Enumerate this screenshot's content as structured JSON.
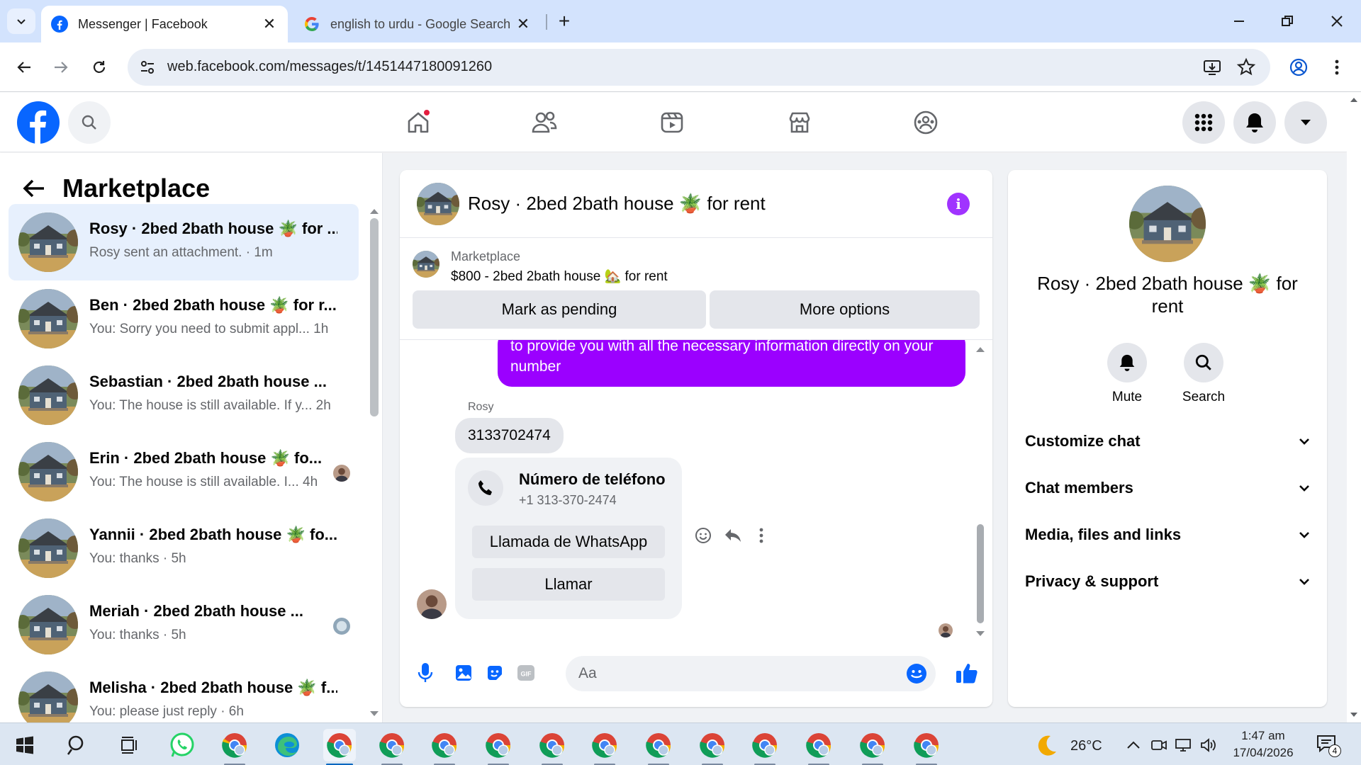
{
  "browser": {
    "tabs": [
      {
        "title": "Messenger | Facebook",
        "active": true
      },
      {
        "title": "english to urdu - Google Search",
        "active": false
      }
    ],
    "url": "web.facebook.com/messages/t/1451447180091260"
  },
  "left_panel": {
    "title": "Marketplace",
    "conversations": [
      {
        "name": "Rosy · 2bed 2bath house 🪴 for ...",
        "preview": "Rosy sent an attachment. · 1m",
        "active": true
      },
      {
        "name": "Ben · 2bed 2bath house 🪴 for r...",
        "preview": "You: Sorry you need to submit appl...  1h"
      },
      {
        "name": "Sebastian · 2bed 2bath house ...",
        "preview": "You: The house is still available. If y...  2h"
      },
      {
        "name": "Erin · 2bed 2bath house 🪴 fo...",
        "preview": "You: The house is still available. I...  4h"
      },
      {
        "name": "Yannii · 2bed 2bath house 🪴 fo...",
        "preview": "You: thanks · 5h"
      },
      {
        "name": "Meriah · 2bed 2bath house ...",
        "preview": "You: thanks · 5h"
      },
      {
        "name": "Melisha · 2bed 2bath house 🪴 f...",
        "preview": "You: please just reply · 6h"
      }
    ]
  },
  "chat": {
    "title": "Rosy · 2bed 2bath house 🪴 for rent",
    "marketplace_label": "Marketplace",
    "listing": "$800 - 2bed 2bath house 🏡 for rent",
    "mark_pending": "Mark as pending",
    "more_options": "More options",
    "outgoing_text": "to provide you with all the necessary information directly on your number",
    "sender": "Rosy",
    "incoming_text": "3133702474",
    "card": {
      "title": "Número de teléfono",
      "number": "+1 313-370-2474",
      "whatsapp_btn": "Llamada de WhatsApp",
      "call_btn": "Llamar"
    },
    "composer_placeholder": "Aa",
    "colors": {
      "outgoing_bubble": "#9b00ff",
      "accent": "#a033ff",
      "fb_blue": "#0866ff"
    }
  },
  "info_panel": {
    "name": "Rosy · 2bed 2bath house 🪴 for rent",
    "actions": [
      {
        "label": "Mute",
        "icon": "bell-icon"
      },
      {
        "label": "Search",
        "icon": "search-icon"
      }
    ],
    "sections": [
      "Customize chat",
      "Chat members",
      "Media, files and links",
      "Privacy & support"
    ]
  },
  "taskbar": {
    "temperature": "26°C",
    "time": "1:47 am",
    "date": "17/04/2026",
    "notification_count": "4"
  }
}
